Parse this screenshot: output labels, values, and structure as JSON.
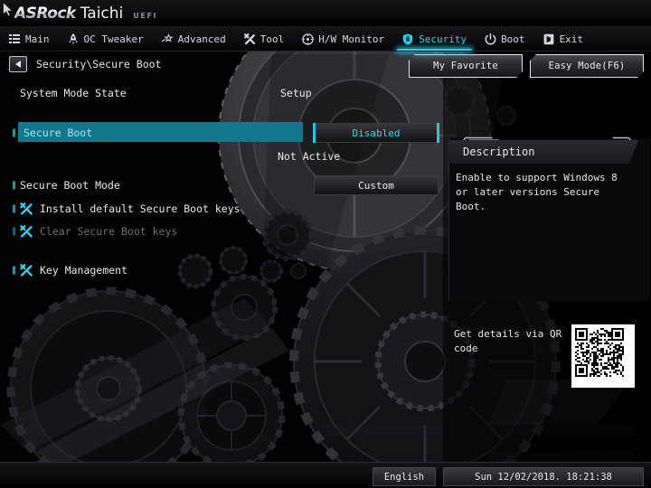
{
  "brand": {
    "logo_primary": "ASRock",
    "logo_secondary": "Taichi",
    "logo_suffix": "UEFI"
  },
  "menubar": {
    "items": [
      {
        "label": "Main",
        "icon": "list-icon",
        "active": false
      },
      {
        "label": "OC Tweaker",
        "icon": "rocket-icon",
        "active": false
      },
      {
        "label": "Advanced",
        "icon": "star-icon",
        "active": false
      },
      {
        "label": "Tool",
        "icon": "wrench-icon",
        "active": false
      },
      {
        "label": "H/W Monitor",
        "icon": "gauge-icon",
        "active": false
      },
      {
        "label": "Security",
        "icon": "shield-icon",
        "active": true
      },
      {
        "label": "Boot",
        "icon": "power-icon",
        "active": false
      },
      {
        "label": "Exit",
        "icon": "exit-icon",
        "active": false
      }
    ]
  },
  "breadcrumb": {
    "back_icon": "back-arrow-icon",
    "path": "Security\\Secure Boot"
  },
  "topbuttons": {
    "my_favorite": "My Favorite",
    "easy_mode": "Easy Mode(F6)"
  },
  "settings": {
    "system_mode_state": {
      "label": "System Mode State",
      "value": "Setup"
    },
    "secure_boot": {
      "label": "Secure Boot",
      "value": "Disabled",
      "status": "Not Active",
      "selected": true
    },
    "secure_boot_mode": {
      "label": "Secure Boot Mode",
      "value": "Custom"
    },
    "install_default_keys": {
      "label": "Install default Secure Boot keys",
      "icon": "wrench-icon",
      "enabled": true
    },
    "clear_keys": {
      "label": "Clear Secure Boot keys",
      "icon": "wrench-icon",
      "enabled": false
    },
    "key_management": {
      "label": "Key Management",
      "icon": "wrench-icon",
      "enabled": true
    }
  },
  "description": {
    "title": "Description",
    "body": "Enable to support Windows 8 or later versions Secure Boot."
  },
  "qr": {
    "label": "Get details via QR code",
    "icon": "qr-code-icon"
  },
  "statusbar": {
    "language": "English",
    "datetime": "Sun 12/02/2018. 18:21:38"
  },
  "colors": {
    "accent_cyan": "#22d3ee",
    "highlight_teal": "#14788c",
    "text_primary": "#e8e8ed",
    "text_dim": "#6d6d73",
    "background": "#020203"
  }
}
